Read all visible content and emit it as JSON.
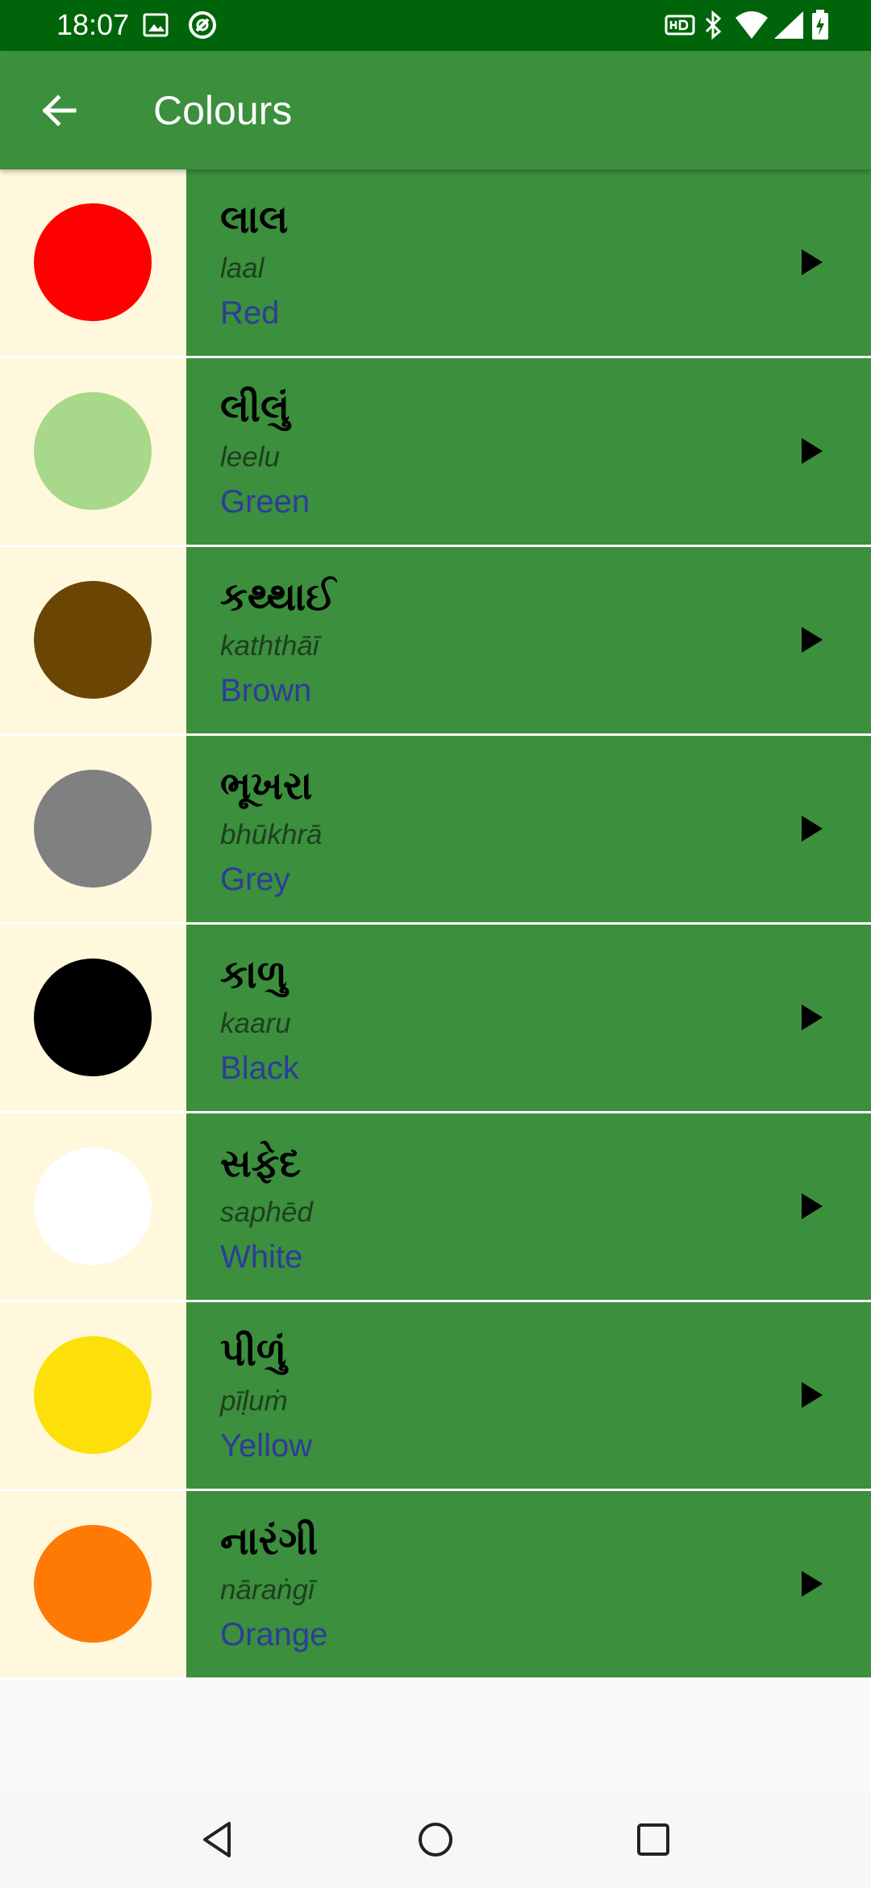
{
  "status_bar": {
    "time": "18:07",
    "icons": [
      "image-icon",
      "sync-icon",
      "hd-icon",
      "bluetooth-icon",
      "wifi-icon",
      "signal-icon",
      "battery-icon"
    ]
  },
  "app_bar": {
    "title": "Colours",
    "back_icon": "arrow-back-icon"
  },
  "colours": [
    {
      "word": "લાલ",
      "translit": "laal",
      "english": "Red",
      "swatch": "#ff0000"
    },
    {
      "word": "લીલું",
      "translit": "leelu",
      "english": "Green",
      "swatch": "#a8d88a"
    },
    {
      "word": "કથ્થાઈ",
      "translit": "kaththāī",
      "english": "Brown",
      "swatch": "#6b4504"
    },
    {
      "word": "ભૂખરા",
      "translit": "bhūkhrā",
      "english": "Grey",
      "swatch": "#808080"
    },
    {
      "word": "કાળુ",
      "translit": "kaaru",
      "english": "Black",
      "swatch": "#000000"
    },
    {
      "word": "સફેદ",
      "translit": "saphēd",
      "english": "White",
      "swatch": "#ffffff"
    },
    {
      "word": "પીળું",
      "translit": "pīḷuṁ",
      "english": "Yellow",
      "swatch": "#fde00a"
    },
    {
      "word": "નારંગી",
      "translit": "nāraṅgī",
      "english": "Orange",
      "swatch": "#ff7a05"
    }
  ],
  "play_icon": "play-icon",
  "nav_bar": {
    "icons": [
      "nav-back-icon",
      "nav-home-icon",
      "nav-recents-icon"
    ]
  },
  "colors": {
    "status_bar": "#00650a",
    "app_bar": "#3b8f3d",
    "row_background": "#3b8f3d",
    "swatch_background": "#fff8dd",
    "english_text": "#2f3c99"
  }
}
